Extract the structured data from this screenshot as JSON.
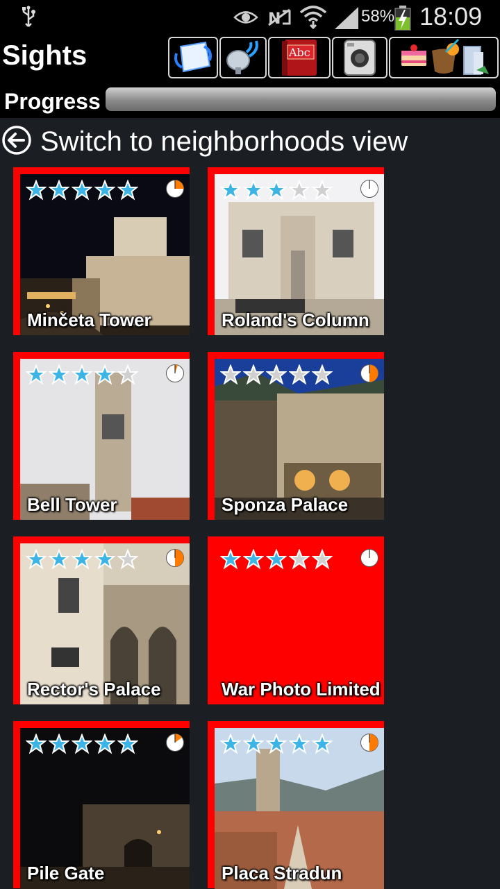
{
  "status_bar": {
    "battery_percent": "58%",
    "time": "18:09",
    "icons": [
      "usb-icon",
      "eye-icon",
      "nfc-icon",
      "wifi-icon",
      "signal-icon",
      "battery-charging-icon"
    ]
  },
  "header": {
    "title": "Sights",
    "toolbar": [
      {
        "name": "map-button",
        "icon": "map-icon"
      },
      {
        "name": "audio-guide-button",
        "icon": "satellite-dish-icon"
      },
      {
        "name": "phrasebook-button",
        "icon": "book-icon",
        "icon_text": "Abc"
      },
      {
        "name": "camera-button",
        "icon": "camera-icon"
      },
      {
        "name": "food-drink-button",
        "icon": "food-drink-icon"
      }
    ]
  },
  "progress": {
    "label": "Progress",
    "value": 0
  },
  "switch_view": {
    "label": "Switch to neighborhoods view",
    "icon": "back-arrow-icon"
  },
  "tiles": [
    {
      "name": "Minčeta Tower",
      "stars_filled": 5,
      "time_fraction": 0.25,
      "accent": "#ff7a00"
    },
    {
      "name": "Roland's Column",
      "stars_filled": 3,
      "time_fraction": 0,
      "accent": "#ff7a00"
    },
    {
      "name": "Bell Tower",
      "stars_filled": 4,
      "time_fraction": 0.05,
      "accent": "#ff7a00"
    },
    {
      "name": "Sponza Palace",
      "stars_filled": 0,
      "time_fraction": 0.5,
      "accent": "#ff7a00"
    },
    {
      "name": "Rector's Palace",
      "stars_filled": 4,
      "time_fraction": 0.5,
      "accent": "#ff7a00"
    },
    {
      "name": "War Photo Limited",
      "stars_filled": 3,
      "time_fraction": 0,
      "accent": "#ff7a00"
    },
    {
      "name": "Pile Gate",
      "stars_filled": 5,
      "time_fraction": 0.15,
      "accent": "#ff7a00"
    },
    {
      "name": "Placa Stradun",
      "stars_filled": 5,
      "time_fraction": 0.5,
      "accent": "#ff7a00"
    }
  ],
  "colors": {
    "tile_border": "#ff0000",
    "star_filled": "#3cb4e6",
    "star_empty": "#d0d0d0",
    "clock_fill": "#ff7a00",
    "background": "#1b1e22"
  }
}
